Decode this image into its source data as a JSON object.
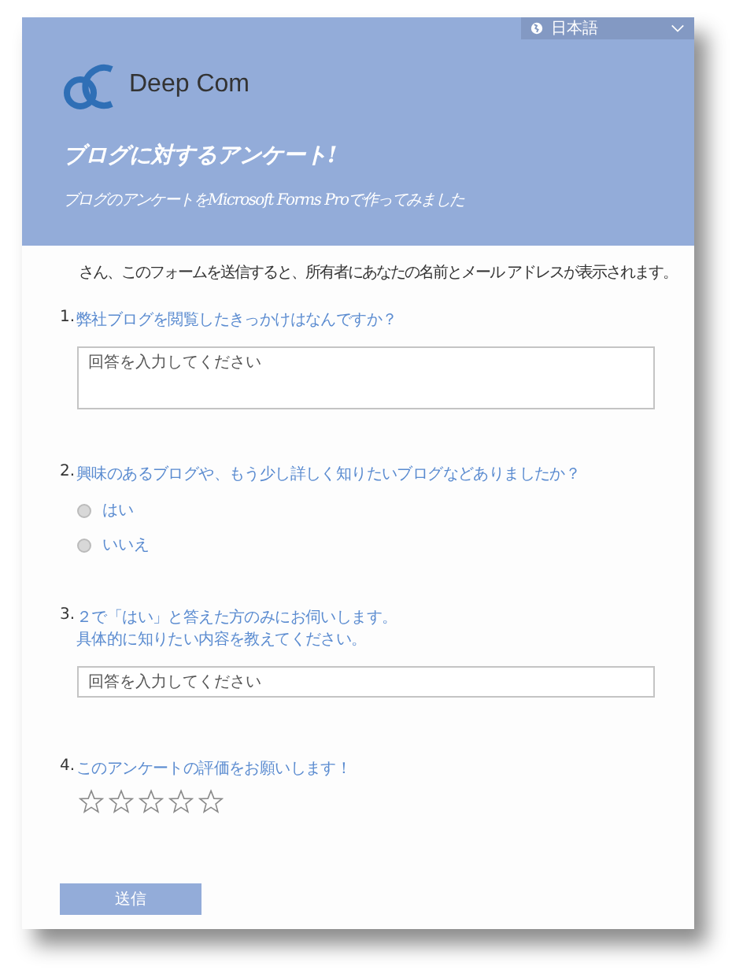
{
  "language": {
    "label": "日本語"
  },
  "header": {
    "company": "Deep Com",
    "title": "ブログに対するアンケート!",
    "subtitle": "ブログのアンケートをMicrosoft Forms Proで作ってみました"
  },
  "notice": "さん、このフォームを送信すると、所有者にあなたの名前とメール アドレスが表示されます。",
  "questions": [
    {
      "kind": "textarea",
      "number": "1.",
      "label": "弊社ブログを閲覧したきっかけはなんですか？",
      "placeholder": "回答を入力してください"
    },
    {
      "kind": "choice",
      "number": "2.",
      "label": "興味のあるブログや、もう少し詳しく知りたいブログなどありましたか？",
      "options": [
        {
          "label": "はい",
          "selected": false
        },
        {
          "label": "いいえ",
          "selected": false
        }
      ]
    },
    {
      "kind": "text",
      "number": "3.",
      "label_lines": [
        "２で「はい」と答えた方のみにお伺いします。",
        "具体的に知りたい内容を教えてください。"
      ],
      "placeholder": "回答を入力してください"
    },
    {
      "kind": "rating",
      "number": "4.",
      "label": "このアンケートの評価をお願いします！",
      "stars": 0
    }
  ],
  "submit": "送信"
}
